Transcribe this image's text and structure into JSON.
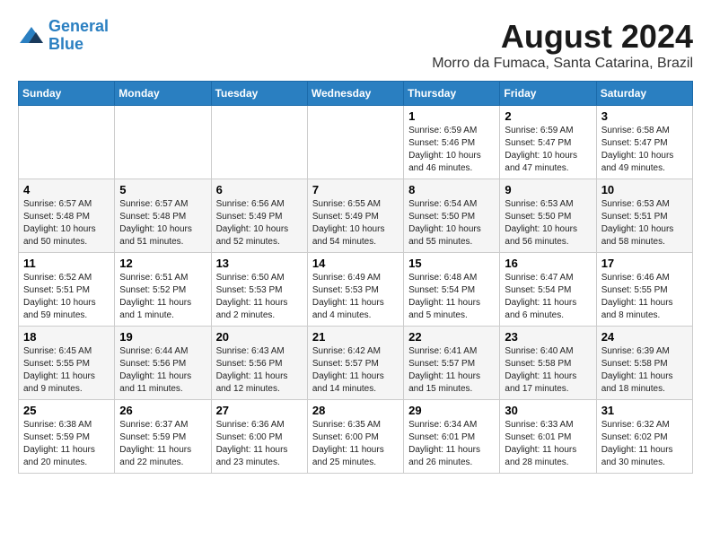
{
  "header": {
    "logo_line1": "General",
    "logo_line2": "Blue",
    "month_year": "August 2024",
    "location": "Morro da Fumaca, Santa Catarina, Brazil"
  },
  "weekdays": [
    "Sunday",
    "Monday",
    "Tuesday",
    "Wednesday",
    "Thursday",
    "Friday",
    "Saturday"
  ],
  "weeks": [
    [
      {
        "day": "",
        "info": ""
      },
      {
        "day": "",
        "info": ""
      },
      {
        "day": "",
        "info": ""
      },
      {
        "day": "",
        "info": ""
      },
      {
        "day": "1",
        "info": "Sunrise: 6:59 AM\nSunset: 5:46 PM\nDaylight: 10 hours\nand 46 minutes."
      },
      {
        "day": "2",
        "info": "Sunrise: 6:59 AM\nSunset: 5:47 PM\nDaylight: 10 hours\nand 47 minutes."
      },
      {
        "day": "3",
        "info": "Sunrise: 6:58 AM\nSunset: 5:47 PM\nDaylight: 10 hours\nand 49 minutes."
      }
    ],
    [
      {
        "day": "4",
        "info": "Sunrise: 6:57 AM\nSunset: 5:48 PM\nDaylight: 10 hours\nand 50 minutes."
      },
      {
        "day": "5",
        "info": "Sunrise: 6:57 AM\nSunset: 5:48 PM\nDaylight: 10 hours\nand 51 minutes."
      },
      {
        "day": "6",
        "info": "Sunrise: 6:56 AM\nSunset: 5:49 PM\nDaylight: 10 hours\nand 52 minutes."
      },
      {
        "day": "7",
        "info": "Sunrise: 6:55 AM\nSunset: 5:49 PM\nDaylight: 10 hours\nand 54 minutes."
      },
      {
        "day": "8",
        "info": "Sunrise: 6:54 AM\nSunset: 5:50 PM\nDaylight: 10 hours\nand 55 minutes."
      },
      {
        "day": "9",
        "info": "Sunrise: 6:53 AM\nSunset: 5:50 PM\nDaylight: 10 hours\nand 56 minutes."
      },
      {
        "day": "10",
        "info": "Sunrise: 6:53 AM\nSunset: 5:51 PM\nDaylight: 10 hours\nand 58 minutes."
      }
    ],
    [
      {
        "day": "11",
        "info": "Sunrise: 6:52 AM\nSunset: 5:51 PM\nDaylight: 10 hours\nand 59 minutes."
      },
      {
        "day": "12",
        "info": "Sunrise: 6:51 AM\nSunset: 5:52 PM\nDaylight: 11 hours\nand 1 minute."
      },
      {
        "day": "13",
        "info": "Sunrise: 6:50 AM\nSunset: 5:53 PM\nDaylight: 11 hours\nand 2 minutes."
      },
      {
        "day": "14",
        "info": "Sunrise: 6:49 AM\nSunset: 5:53 PM\nDaylight: 11 hours\nand 4 minutes."
      },
      {
        "day": "15",
        "info": "Sunrise: 6:48 AM\nSunset: 5:54 PM\nDaylight: 11 hours\nand 5 minutes."
      },
      {
        "day": "16",
        "info": "Sunrise: 6:47 AM\nSunset: 5:54 PM\nDaylight: 11 hours\nand 6 minutes."
      },
      {
        "day": "17",
        "info": "Sunrise: 6:46 AM\nSunset: 5:55 PM\nDaylight: 11 hours\nand 8 minutes."
      }
    ],
    [
      {
        "day": "18",
        "info": "Sunrise: 6:45 AM\nSunset: 5:55 PM\nDaylight: 11 hours\nand 9 minutes."
      },
      {
        "day": "19",
        "info": "Sunrise: 6:44 AM\nSunset: 5:56 PM\nDaylight: 11 hours\nand 11 minutes."
      },
      {
        "day": "20",
        "info": "Sunrise: 6:43 AM\nSunset: 5:56 PM\nDaylight: 11 hours\nand 12 minutes."
      },
      {
        "day": "21",
        "info": "Sunrise: 6:42 AM\nSunset: 5:57 PM\nDaylight: 11 hours\nand 14 minutes."
      },
      {
        "day": "22",
        "info": "Sunrise: 6:41 AM\nSunset: 5:57 PM\nDaylight: 11 hours\nand 15 minutes."
      },
      {
        "day": "23",
        "info": "Sunrise: 6:40 AM\nSunset: 5:58 PM\nDaylight: 11 hours\nand 17 minutes."
      },
      {
        "day": "24",
        "info": "Sunrise: 6:39 AM\nSunset: 5:58 PM\nDaylight: 11 hours\nand 18 minutes."
      }
    ],
    [
      {
        "day": "25",
        "info": "Sunrise: 6:38 AM\nSunset: 5:59 PM\nDaylight: 11 hours\nand 20 minutes."
      },
      {
        "day": "26",
        "info": "Sunrise: 6:37 AM\nSunset: 5:59 PM\nDaylight: 11 hours\nand 22 minutes."
      },
      {
        "day": "27",
        "info": "Sunrise: 6:36 AM\nSunset: 6:00 PM\nDaylight: 11 hours\nand 23 minutes."
      },
      {
        "day": "28",
        "info": "Sunrise: 6:35 AM\nSunset: 6:00 PM\nDaylight: 11 hours\nand 25 minutes."
      },
      {
        "day": "29",
        "info": "Sunrise: 6:34 AM\nSunset: 6:01 PM\nDaylight: 11 hours\nand 26 minutes."
      },
      {
        "day": "30",
        "info": "Sunrise: 6:33 AM\nSunset: 6:01 PM\nDaylight: 11 hours\nand 28 minutes."
      },
      {
        "day": "31",
        "info": "Sunrise: 6:32 AM\nSunset: 6:02 PM\nDaylight: 11 hours\nand 30 minutes."
      }
    ]
  ]
}
